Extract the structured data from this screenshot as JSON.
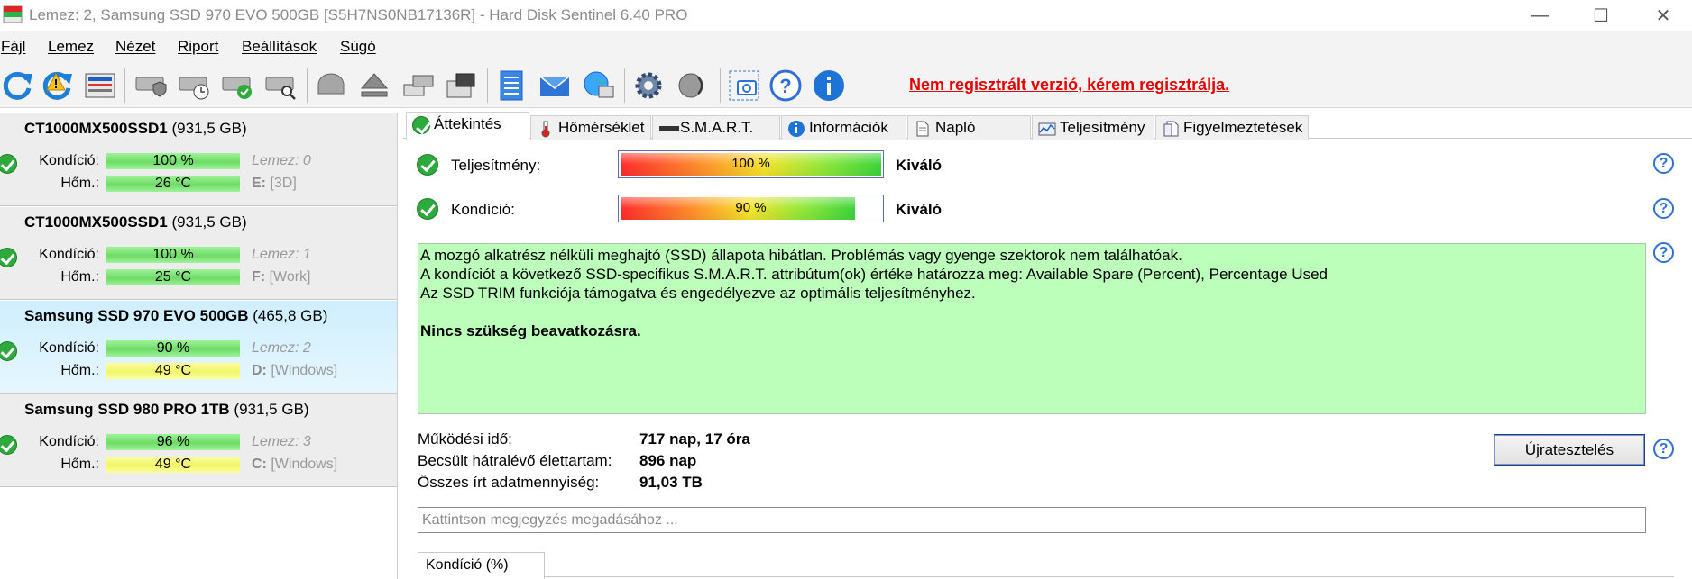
{
  "window": {
    "title": "Lemez: 2, Samsung SSD 970 EVO 500GB [S5H7NS0NB17136R]  -  Hard Disk Sentinel 6.40 PRO",
    "minimize": "—",
    "maximize": "☐",
    "close": "✕"
  },
  "menu": [
    "Fájl",
    "Lemez",
    "Nézet",
    "Riport",
    "Beállítások",
    "Súgó"
  ],
  "toolbar": {
    "icons": [
      "refresh-icon",
      "refresh-warning-icon",
      "disk-panel-icon",
      "disk-shield-icon",
      "disk-clock-icon",
      "disk-check-icon",
      "disk-search-icon",
      "disk-gray-icon",
      "eject-icon",
      "drives-icon",
      "drive-box-icon",
      "report-icon",
      "mail-icon",
      "network-icon",
      "settings-icon",
      "sound-icon",
      "screenshot-icon",
      "help-icon",
      "info-icon"
    ],
    "unregistered": "Nem regisztrált verzió, kérem regisztrálja."
  },
  "disks": [
    {
      "name": "CT1000MX500SSD1",
      "size": "(931,5 GB)",
      "condition_label": "Kondíció:",
      "condition": "100 %",
      "condition_pct": 100,
      "temp_label": "Hőm.:",
      "temp": "26 °C",
      "temp_color": "green",
      "index": "Lemez: 0",
      "drive": "E:",
      "volume": "[3D]"
    },
    {
      "name": "CT1000MX500SSD1",
      "size": "(931,5 GB)",
      "condition_label": "Kondíció:",
      "condition": "100 %",
      "condition_pct": 100,
      "temp_label": "Hőm.:",
      "temp": "25 °C",
      "temp_color": "green",
      "index": "Lemez: 1",
      "drive": "F:",
      "volume": "[Work]"
    },
    {
      "name": "Samsung SSD 970 EVO 500GB",
      "size": "(465,8 GB)",
      "condition_label": "Kondíció:",
      "condition": "90 %",
      "condition_pct": 90,
      "temp_label": "Hőm.:",
      "temp": "49 °C",
      "temp_color": "yellow",
      "index": "Lemez: 2",
      "drive": "D:",
      "volume": "[Windows]",
      "selected": true
    },
    {
      "name": "Samsung SSD 980 PRO 1TB",
      "size": "(931,5 GB)",
      "condition_label": "Kondíció:",
      "condition": "96 %",
      "condition_pct": 96,
      "temp_label": "Hőm.:",
      "temp": "49 °C",
      "temp_color": "yellow",
      "index": "Lemez: 3",
      "drive": "C:",
      "volume": "[Windows]"
    }
  ],
  "tabs": [
    {
      "label": "Áttekintés",
      "icon": "check-icon",
      "active": true
    },
    {
      "label": "Hőmérséklet",
      "icon": "thermometer-icon"
    },
    {
      "label": "S.M.A.R.T.",
      "icon": "smart-icon"
    },
    {
      "label": "Információk",
      "icon": "info-icon"
    },
    {
      "label": "Napló",
      "icon": "document-icon"
    },
    {
      "label": "Teljesítmény",
      "icon": "chart-icon"
    },
    {
      "label": "Figyelmeztetések",
      "icon": "alerts-icon"
    }
  ],
  "overview": {
    "performance": {
      "label": "Teljesítmény:",
      "value": "100 %",
      "pct": 100,
      "rating": "Kiváló"
    },
    "condition": {
      "label": "Kondíció:",
      "value": "90 %",
      "pct": 90,
      "rating": "Kiváló"
    },
    "status_lines": [
      "A mozgó alkatrész nélküli meghajtó (SSD) állapota hibátlan. Problémás vagy gyenge szektorok nem találhatóak.",
      "A kondíciót a következő SSD-specifikus S.M.A.R.T. attribútum(ok) értéke határozza meg:  Available Spare (Percent), Percentage Used",
      "Az SSD TRIM funkciója támogatva és engedélyezve az optimális teljesítményhez."
    ],
    "status_action": "Nincs szükség beavatkozásra.",
    "power_on_label": "Működési idő:",
    "power_on_value": "717 nap, 17 óra",
    "remaining_label": "Becsült hátralévő élettartam:",
    "remaining_value": "896 nap",
    "written_label": "Összes írt adatmennyiség:",
    "written_value": "91,03 TB",
    "retest_button": "Újratesztelés",
    "note_placeholder": "Kattintson megjegyzés megadásához ...",
    "subtab": "Kondíció  (%)"
  },
  "colors": {
    "selected_disk": "#cfeefd",
    "status_bg": "#bbffbb",
    "unregistered": "#e60000",
    "ok_green": "#2eaa3c"
  }
}
